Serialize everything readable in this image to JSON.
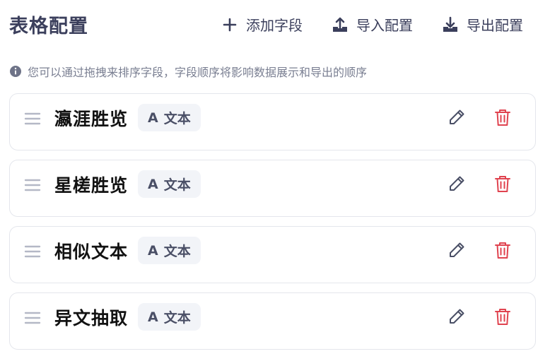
{
  "page": {
    "title": "表格配置",
    "hint": "您可以通过拖拽来排序字段，字段顺序将影响数据展示和导出的顺序"
  },
  "toolbar": {
    "add_label": "添加字段",
    "import_label": "导入配置",
    "export_label": "导出配置"
  },
  "fields": [
    {
      "name": "瀛涯胜览",
      "type_label": "文本",
      "type_icon": "A"
    },
    {
      "name": "星槎胜览",
      "type_label": "文本",
      "type_icon": "A"
    },
    {
      "name": "相似文本",
      "type_label": "文本",
      "type_icon": "A"
    },
    {
      "name": "异文抽取",
      "type_label": "文本",
      "type_icon": "A"
    }
  ],
  "colors": {
    "title": "#3b3f5c",
    "delete": "#e0434f",
    "edit": "#4a4f66",
    "tag_bg": "#f2f4f8",
    "border": "#e4e6ec",
    "handle": "#b4b8c6"
  },
  "icons": {
    "add": "plus-icon",
    "import": "upload-icon",
    "export": "download-icon",
    "hint": "info-icon",
    "drag": "drag-handle-icon",
    "edit": "pencil-icon",
    "delete": "trash-icon"
  }
}
